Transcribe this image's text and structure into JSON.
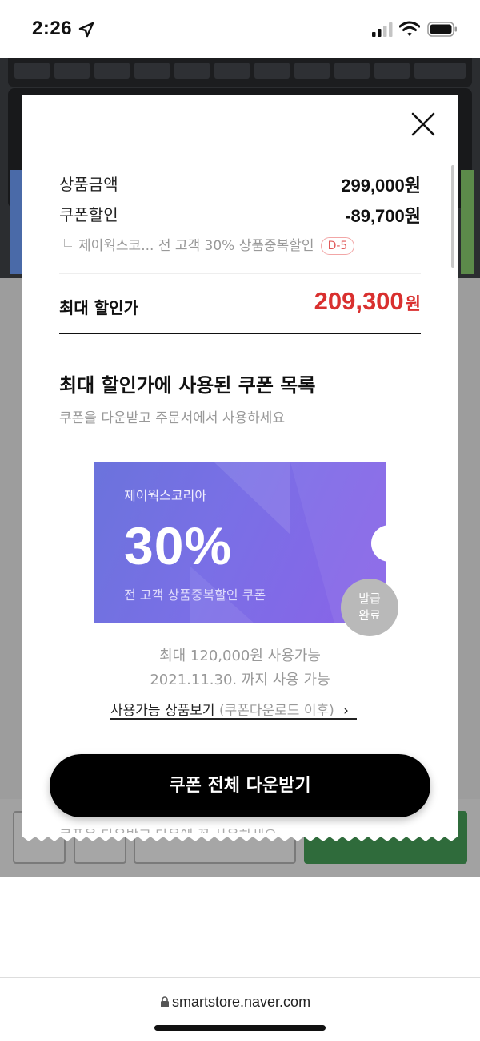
{
  "status_bar": {
    "time": "2:26"
  },
  "modal": {
    "price_rows": [
      {
        "label": "상품금액",
        "value": "299,000원"
      },
      {
        "label": "쿠폰할인",
        "value": "-89,700원"
      }
    ],
    "coupon_detail": {
      "text": "제이웍스코... 전 고객 30% 상품중복할인",
      "dday": "D-5"
    },
    "max_discount": {
      "label": "최대 할인가",
      "value": "209,300",
      "unit": "원"
    },
    "section": {
      "title": "최대 할인가에 사용된 쿠폰 목록",
      "subtitle": "쿠폰을 다운받고 주문서에서 사용하세요"
    },
    "coupon": {
      "brand": "제이웍스코리아",
      "percent": "30%",
      "description": "전 고객 상품중복할인 쿠폰",
      "badge_line1": "발급",
      "badge_line2": "완료",
      "max_use": "최대 120,000원 사용가능",
      "valid_until": "2021.11.30. 까지 사용 가능"
    },
    "products_link": {
      "label": "사용가능 상품보기",
      "hint": "(쿠폰다운로드 이후)",
      "chevron": "›"
    },
    "peek_text": "쿠폰을 다운받고 다음에 꼭 사용하세요",
    "download_button": "쿠폰 전체 다운받기"
  },
  "browser": {
    "url": "smartstore.naver.com"
  },
  "colors": {
    "accent_red": "#d9302f",
    "coupon_purple": "#7a6fe6",
    "button_black": "#000000"
  }
}
